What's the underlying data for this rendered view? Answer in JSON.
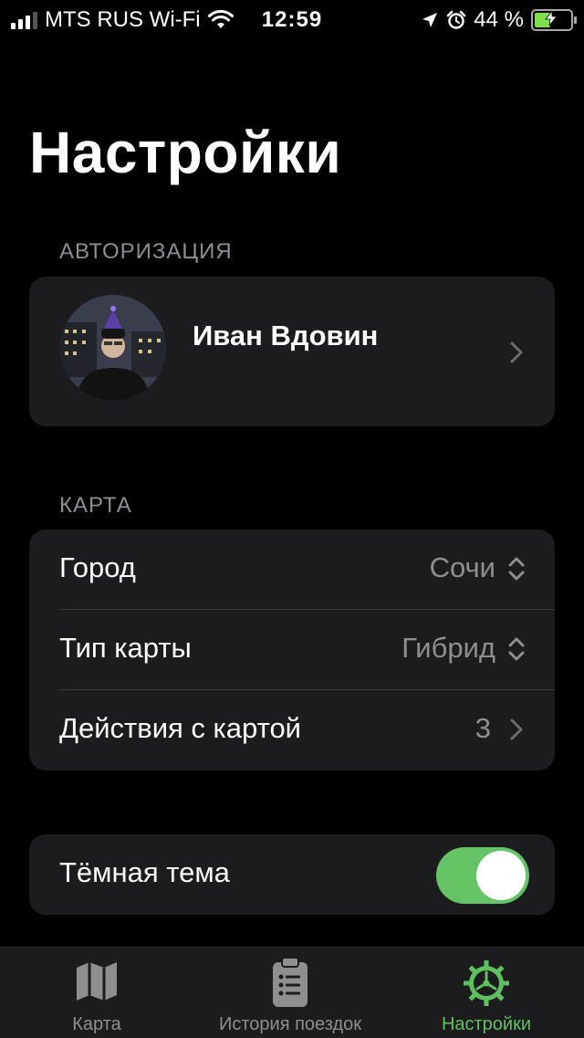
{
  "status_bar": {
    "carrier": "MTS RUS Wi-Fi",
    "time": "12:59",
    "battery_percent": "44 %",
    "battery_level": 0.44,
    "battery_color": "#7fe04f"
  },
  "title": "Настройки",
  "authorization": {
    "section_label": "АВТОРИЗАЦИЯ",
    "user_name": "Иван Вдовин"
  },
  "map": {
    "section_label": "КАРТА",
    "rows": [
      {
        "label": "Город",
        "value": "Сочи",
        "icon": "chevron-up-down-icon"
      },
      {
        "label": "Тип карты",
        "value": "Гибрид",
        "icon": "chevron-up-down-icon"
      },
      {
        "label": "Действия с картой",
        "value": "3",
        "icon": "chevron-right-icon"
      }
    ]
  },
  "theme": {
    "label": "Тёмная тема",
    "enabled": true,
    "toggle_color": "#65c466"
  },
  "tab_bar": {
    "active_color": "#5fc05f",
    "inactive_color": "#8e8e93",
    "tabs": [
      {
        "label": "Карта",
        "icon": "map-icon",
        "active": false
      },
      {
        "label": "История поездок",
        "icon": "clipboard-list-icon",
        "active": false
      },
      {
        "label": "Настройки",
        "icon": "gear-icon",
        "active": true
      }
    ]
  }
}
